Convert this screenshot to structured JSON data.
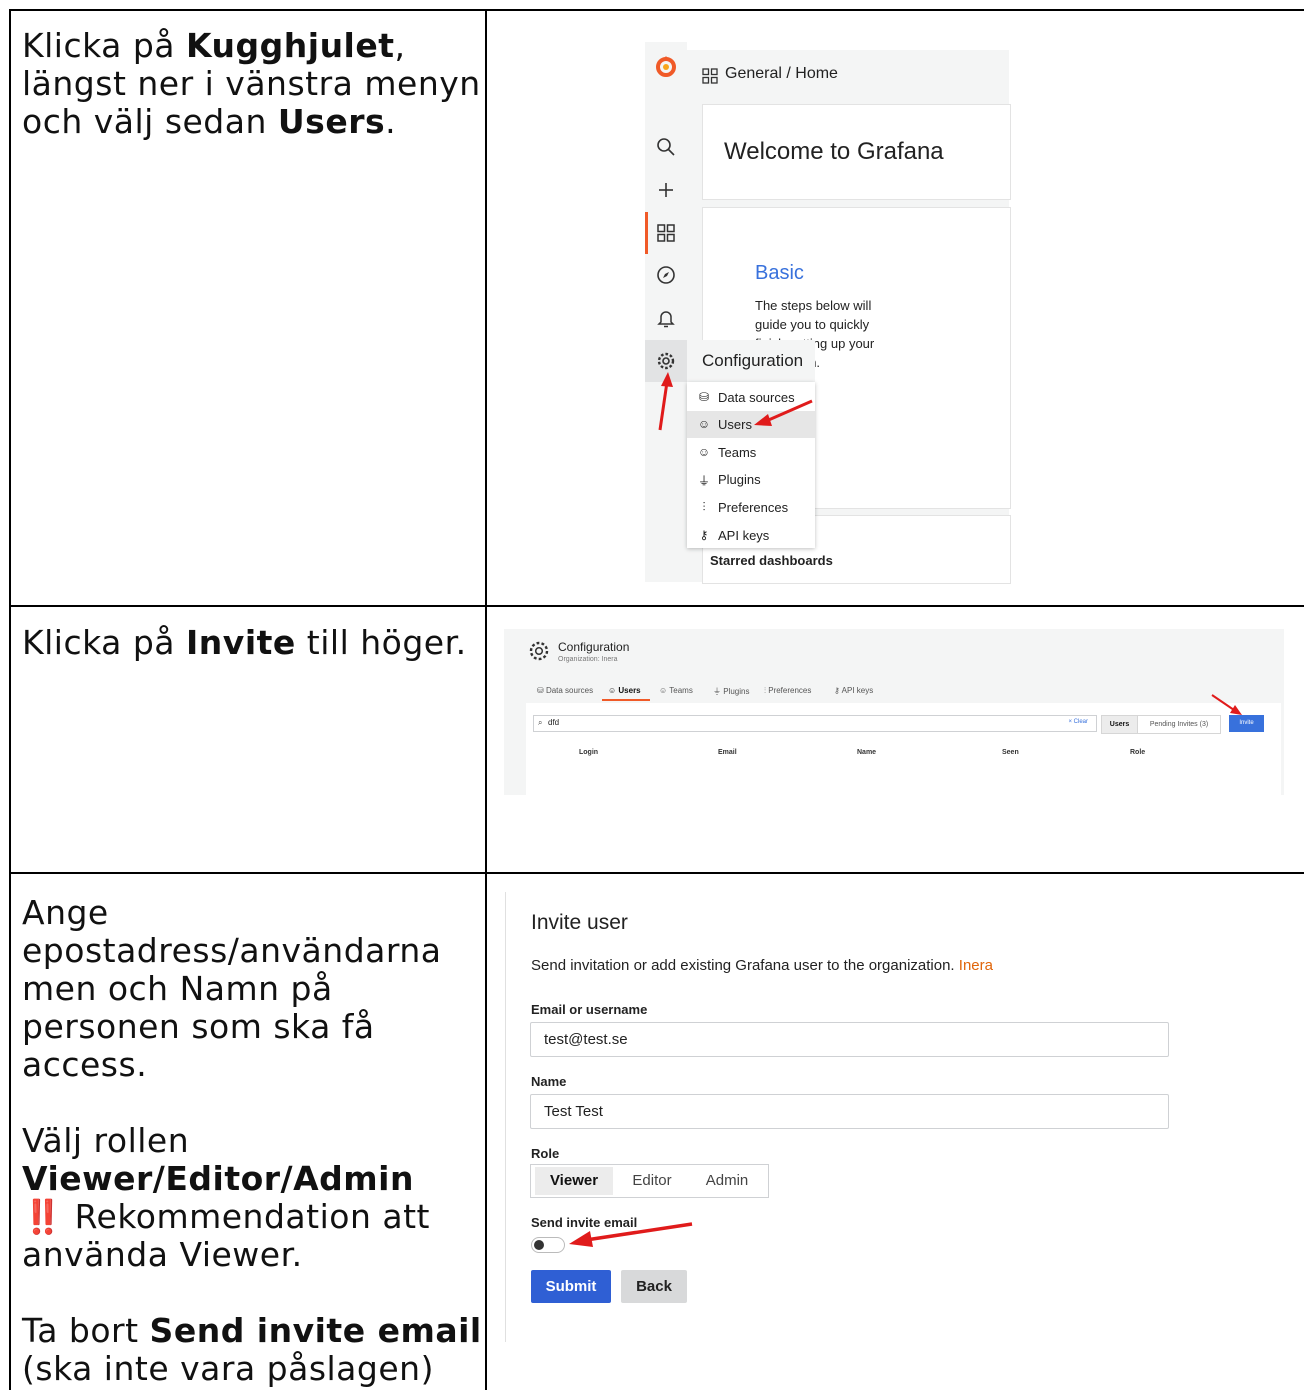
{
  "rows": [
    {
      "instruction": {
        "line1_pre": "Klicka på ",
        "line1_bold": "Kugghjulet",
        "line1_post": ",",
        "line2": "längst ner i vänstra menyn",
        "line3_pre": "och välj sedan ",
        "line3_bold": "Users",
        "line3_post": "."
      },
      "screenshot": {
        "breadcrumb": "General / Home",
        "welcome": "Welcome to Grafana",
        "basic_title": "Basic",
        "steps_text": [
          "The steps below will",
          "guide you to quickly",
          "finish setting up your",
          "installation."
        ],
        "config_title": "Configuration",
        "menu": [
          {
            "label": "Data sources",
            "icon": "database-icon"
          },
          {
            "label": "Users",
            "icon": "user-icon"
          },
          {
            "label": "Teams",
            "icon": "users-icon"
          },
          {
            "label": "Plugins",
            "icon": "plug-icon"
          },
          {
            "label": "Preferences",
            "icon": "sliders-icon"
          },
          {
            "label": "API keys",
            "icon": "key-icon"
          }
        ],
        "starred": "Starred dashboards"
      }
    },
    {
      "instruction": {
        "pre": "Klicka på ",
        "bold": "Invite",
        "post": " till höger."
      },
      "screenshot": {
        "title": "Configuration",
        "subtitle": "Organization: Inera",
        "tabs": [
          "Data sources",
          "Users",
          "Teams",
          "Plugins",
          "Preferences",
          "API keys"
        ],
        "search_value": "dfd",
        "clear_label": "× Clear",
        "seg_users": "Users",
        "seg_pending": "Pending Invites (3)",
        "invite_label": "Invite",
        "columns": [
          "Login",
          "Email",
          "Name",
          "Seen",
          "Role"
        ]
      }
    },
    {
      "instruction": {
        "p1_lines": [
          "Ange",
          "epostadress/användarna",
          "men och Namn på",
          "personen som ska få",
          "access."
        ],
        "p2_line1": "Välj rollen",
        "p2_bold": "Viewer/Editor/Admin",
        "p2_icon": "‼️",
        "p2_line3": "Rekommendation att",
        "p2_line4": "använda Viewer.",
        "p3_pre": "Ta bort ",
        "p3_bold": "Send invite email",
        "p3_line2": "(ska inte vara påslagen)"
      },
      "screenshot": {
        "title": "Invite user",
        "description": "Send invitation or add existing Grafana user to the organization.",
        "org_name": "Inera",
        "email_label": "Email or username",
        "email_value": "test@test.se",
        "name_label": "Name",
        "name_value": "Test Test",
        "role_label": "Role",
        "roles": [
          "Viewer",
          "Editor",
          "Admin"
        ],
        "selected_role": "Viewer",
        "send_invite_label": "Send invite email",
        "send_invite_on": false,
        "submit_label": "Submit",
        "back_label": "Back"
      }
    }
  ],
  "colors": {
    "accent_orange": "#f05a28",
    "grafana_blue": "#3871dc",
    "arrow_red": "#e01b1b"
  }
}
